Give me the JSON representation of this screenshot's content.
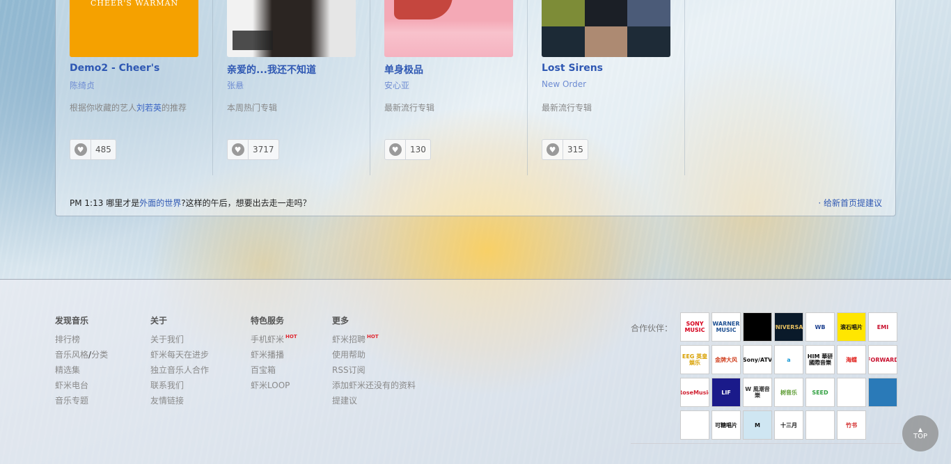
{
  "albums": [
    {
      "title": "Demo2 - Cheer's",
      "artist": "陈绮贞",
      "reason_prefix": "根据你收藏的艺人",
      "reason_link": "刘若英",
      "reason_suffix": "的推荐",
      "favorites": "485",
      "cover_text": "CHEER'S WARMAN"
    },
    {
      "title": "亲爱的...我还不知道",
      "artist": "张悬",
      "reason": "本周热门专辑",
      "favorites": "3717"
    },
    {
      "title": "单身极品",
      "artist": "安心亚",
      "reason": "最新流行专辑",
      "favorites": "130"
    },
    {
      "title": "Lost Sirens",
      "artist": "New Order",
      "reason": "最新流行专辑",
      "favorites": "315"
    }
  ],
  "status": {
    "time": "PM 1:13",
    "text_before": "哪里才是",
    "link": "外面的世界",
    "text_after": "?这样的午后，想要出去走一走吗？",
    "suggest": "· 给新首页提建议"
  },
  "footer": {
    "discover": {
      "heading": "发现音乐",
      "items": [
        "排行榜",
        "音乐风格",
        "/",
        "分类",
        "精选集",
        "虾米电台",
        "音乐专题"
      ]
    },
    "about": {
      "heading": "关于",
      "items": [
        "关于我们",
        "虾米每天在进步",
        "独立音乐人合作",
        "联系我们",
        "友情链接"
      ]
    },
    "services": {
      "heading": "特色服务",
      "items": [
        "手机虾米",
        "虾米播播",
        "百宝箱",
        "虾米LOOP"
      ],
      "hot": "HOT"
    },
    "more": {
      "heading": "更多",
      "items": [
        "虾米招聘",
        "使用帮助",
        "RSS订阅",
        "添加虾米还没有的资料",
        "提建议"
      ],
      "hot": "HOT"
    },
    "partners_label": "合作伙伴：",
    "top_label": "TOP"
  },
  "partner_logos": [
    {
      "text": "SONY MUSIC",
      "bg": "#ffffff",
      "fg": "#d6001c"
    },
    {
      "text": "WARNER MUSIC",
      "bg": "#ffffff",
      "fg": "#1d4f91"
    },
    {
      "text": "",
      "bg": "#000000",
      "fg": "#ffffff"
    },
    {
      "text": "UNIVERSAL",
      "bg": "#0a1a2a",
      "fg": "#e8c060"
    },
    {
      "text": "WB",
      "bg": "#ffffff",
      "fg": "#1b3f8f"
    },
    {
      "text": "滚石唱片",
      "bg": "#ffe600",
      "fg": "#111111"
    },
    {
      "text": "EMI",
      "bg": "#ffffff",
      "fg": "#c8102e"
    },
    {
      "text": "EEG 英皇娱乐",
      "bg": "#ffffff",
      "fg": "#d8a000"
    },
    {
      "text": "金牌大风",
      "bg": "#ffffff",
      "fg": "#d04020"
    },
    {
      "text": "Sony/ATV",
      "bg": "#ffffff",
      "fg": "#111111"
    },
    {
      "text": "a",
      "bg": "#ffffff",
      "fg": "#1a9ad6"
    },
    {
      "text": "HIM 華研國際音樂",
      "bg": "#ffffff",
      "fg": "#111111"
    },
    {
      "text": "海蝶",
      "bg": "#ffffff",
      "fg": "#e0201c"
    },
    {
      "text": "FORWARD",
      "bg": "#ffffff",
      "fg": "#c8102e"
    },
    {
      "text": "RoseMusic",
      "bg": "#ffffff",
      "fg": "#d02030"
    },
    {
      "text": "LIF",
      "bg": "#1a1a8a",
      "fg": "#ffffff"
    },
    {
      "text": "W 風潮音樂",
      "bg": "#ffffff",
      "fg": "#333333"
    },
    {
      "text": "树音乐",
      "bg": "#ffffff",
      "fg": "#5a9a30"
    },
    {
      "text": "SEED",
      "bg": "#ffffff",
      "fg": "#30a040"
    },
    {
      "text": "",
      "bg": "#ffffff",
      "fg": "#1aa0e0"
    },
    {
      "text": "",
      "bg": "#2a7ab8",
      "fg": "#ffffff"
    },
    {
      "text": "",
      "bg": "#ffffff",
      "fg": "#a07820"
    },
    {
      "text": "可糖唱片",
      "bg": "#ffffff",
      "fg": "#111111"
    },
    {
      "text": "M",
      "bg": "#cfe6f2",
      "fg": "#111111"
    },
    {
      "text": "十三月",
      "bg": "#ffffff",
      "fg": "#111111"
    },
    {
      "text": "",
      "bg": "#ffffff",
      "fg": "#111111"
    },
    {
      "text": "竹书",
      "bg": "#ffffff",
      "fg": "#d02020"
    }
  ]
}
